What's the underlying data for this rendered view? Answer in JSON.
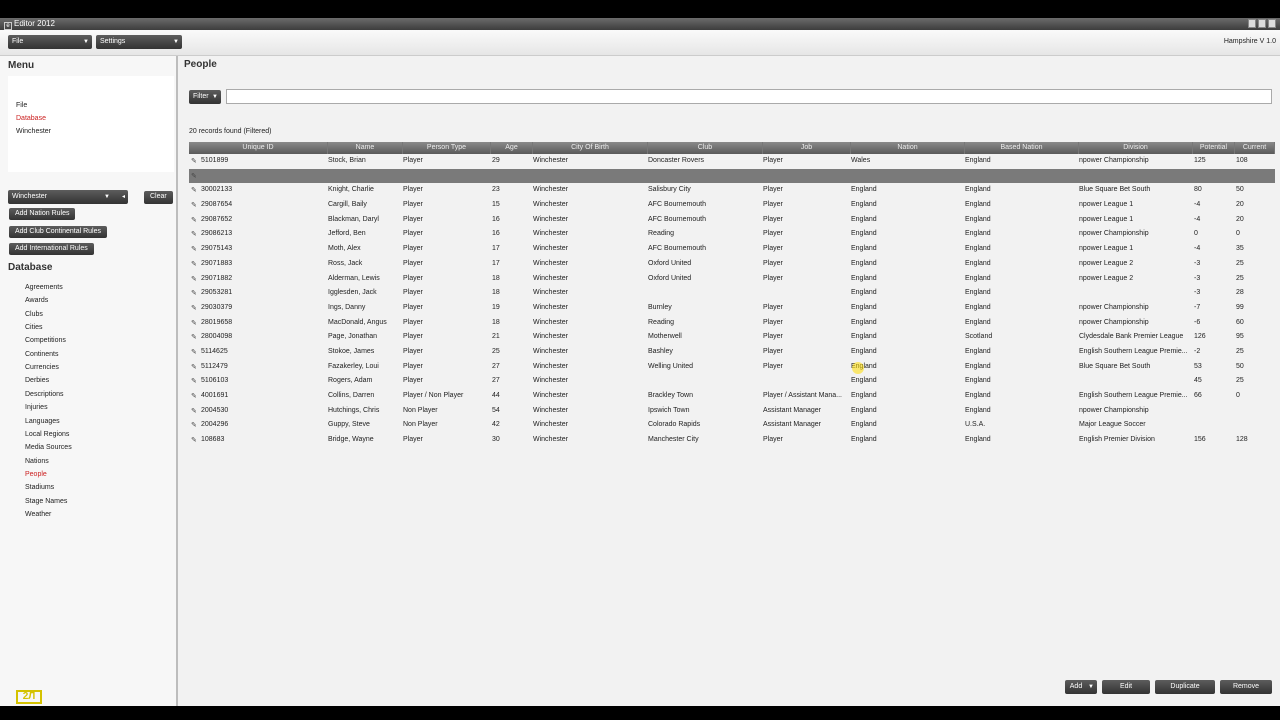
{
  "window": {
    "title": "Editor 2012"
  },
  "topbar": {
    "file_label": "File",
    "settings_label": "Settings",
    "version": "Hampshire V 1.0"
  },
  "sidebar": {
    "menu_title": "Menu",
    "menu_items": [
      "File",
      "Database",
      "Winchester"
    ],
    "filter_select_value": "Winchester",
    "clear_label": "Clear",
    "rule_buttons": [
      "Add Nation Rules",
      "Add Club Continental Rules",
      "Add International Rules"
    ],
    "database_title": "Database",
    "database_items": [
      "Agreements",
      "Awards",
      "Clubs",
      "Cities",
      "Competitions",
      "Continents",
      "Currencies",
      "Derbies",
      "Descriptions",
      "Injuries",
      "Languages",
      "Local Regions",
      "Media Sources",
      "Nations",
      "People",
      "Stadiums",
      "Stage Names",
      "Weather"
    ],
    "logo_text": "2Л"
  },
  "main": {
    "title": "People",
    "filter_label": "Filter",
    "filter_value": "",
    "records_found": "20 records found (Filtered)",
    "columns": [
      "Unique ID",
      "Name",
      "Person Type",
      "Age",
      "City Of Birth",
      "Club",
      "Job",
      "Nation",
      "Based Nation",
      "Division",
      "Potential",
      "Current"
    ],
    "rows": [
      [
        "5101899",
        "Stock, Brian",
        "Player",
        "29",
        "Winchester",
        "Doncaster Rovers",
        "Player",
        "Wales",
        "England",
        "npower Championship",
        "125",
        "108"
      ],
      [
        "",
        "",
        "",
        "",
        "",
        "",
        "",
        "",
        "",
        "",
        "",
        ""
      ],
      [
        "30002133",
        "Knight, Charlie",
        "Player",
        "23",
        "Winchester",
        "Salisbury City",
        "Player",
        "England",
        "England",
        "Blue Square Bet South",
        "80",
        "50"
      ],
      [
        "29087654",
        "Cargill, Baily",
        "Player",
        "15",
        "Winchester",
        "AFC Bournemouth",
        "Player",
        "England",
        "England",
        "npower League 1",
        "-4",
        "20"
      ],
      [
        "29087652",
        "Blackman, Daryl",
        "Player",
        "16",
        "Winchester",
        "AFC Bournemouth",
        "Player",
        "England",
        "England",
        "npower League 1",
        "-4",
        "20"
      ],
      [
        "29086213",
        "Jefford, Ben",
        "Player",
        "16",
        "Winchester",
        "Reading",
        "Player",
        "England",
        "England",
        "npower Championship",
        "0",
        "0"
      ],
      [
        "29075143",
        "Moth, Alex",
        "Player",
        "17",
        "Winchester",
        "AFC Bournemouth",
        "Player",
        "England",
        "England",
        "npower League 1",
        "-4",
        "35"
      ],
      [
        "29071883",
        "Ross, Jack",
        "Player",
        "17",
        "Winchester",
        "Oxford United",
        "Player",
        "England",
        "England",
        "npower League 2",
        "-3",
        "25"
      ],
      [
        "29071882",
        "Alderman, Lewis",
        "Player",
        "18",
        "Winchester",
        "Oxford United",
        "Player",
        "England",
        "England",
        "npower League 2",
        "-3",
        "25"
      ],
      [
        "29053281",
        "Igglesden, Jack",
        "Player",
        "18",
        "Winchester",
        "",
        "",
        "England",
        "England",
        "",
        "-3",
        "28"
      ],
      [
        "29030379",
        "Ings, Danny",
        "Player",
        "19",
        "Winchester",
        "Burnley",
        "Player",
        "England",
        "England",
        "npower Championship",
        "-7",
        "99"
      ],
      [
        "28019658",
        "MacDonald, Angus",
        "Player",
        "18",
        "Winchester",
        "Reading",
        "Player",
        "England",
        "England",
        "npower Championship",
        "-6",
        "60"
      ],
      [
        "28004098",
        "Page, Jonathan",
        "Player",
        "21",
        "Winchester",
        "Motherwell",
        "Player",
        "England",
        "Scotland",
        "Clydesdale Bank Premier League",
        "126",
        "95"
      ],
      [
        "5114625",
        "Stokoe, James",
        "Player",
        "25",
        "Winchester",
        "Bashley",
        "Player",
        "England",
        "England",
        "English Southern League Premie...",
        "-2",
        "25"
      ],
      [
        "5112479",
        "Fazakerley, Loui",
        "Player",
        "27",
        "Winchester",
        "Welling United",
        "Player",
        "England",
        "England",
        "Blue Square Bet South",
        "53",
        "50"
      ],
      [
        "5106103",
        "Rogers, Adam",
        "Player",
        "27",
        "Winchester",
        "",
        "",
        "England",
        "England",
        "",
        "45",
        "25"
      ],
      [
        "4001691",
        "Collins, Darren",
        "Player / Non Player",
        "44",
        "Winchester",
        "Brackley Town",
        "Player / Assistant Mana...",
        "England",
        "England",
        "English Southern League Premie...",
        "66",
        "0"
      ],
      [
        "2004530",
        "Hutchings, Chris",
        "Non Player",
        "54",
        "Winchester",
        "Ipswich Town",
        "Assistant Manager",
        "England",
        "England",
        "npower Championship",
        "",
        ""
      ],
      [
        "2004296",
        "Guppy, Steve",
        "Non Player",
        "42",
        "Winchester",
        "Colorado Rapids",
        "Assistant Manager",
        "England",
        "U.S.A.",
        "Major League Soccer",
        "",
        ""
      ],
      [
        "108683",
        "Bridge, Wayne",
        "Player",
        "30",
        "Winchester",
        "Manchester City",
        "Player",
        "England",
        "England",
        "English Premier Division",
        "156",
        "128"
      ]
    ],
    "buttons": [
      "Add",
      "Edit",
      "Duplicate",
      "Remove"
    ]
  },
  "colors": {
    "accent_red": "#cc2222",
    "button_dark": "#333333",
    "header_grey": "#6a6a6a"
  }
}
